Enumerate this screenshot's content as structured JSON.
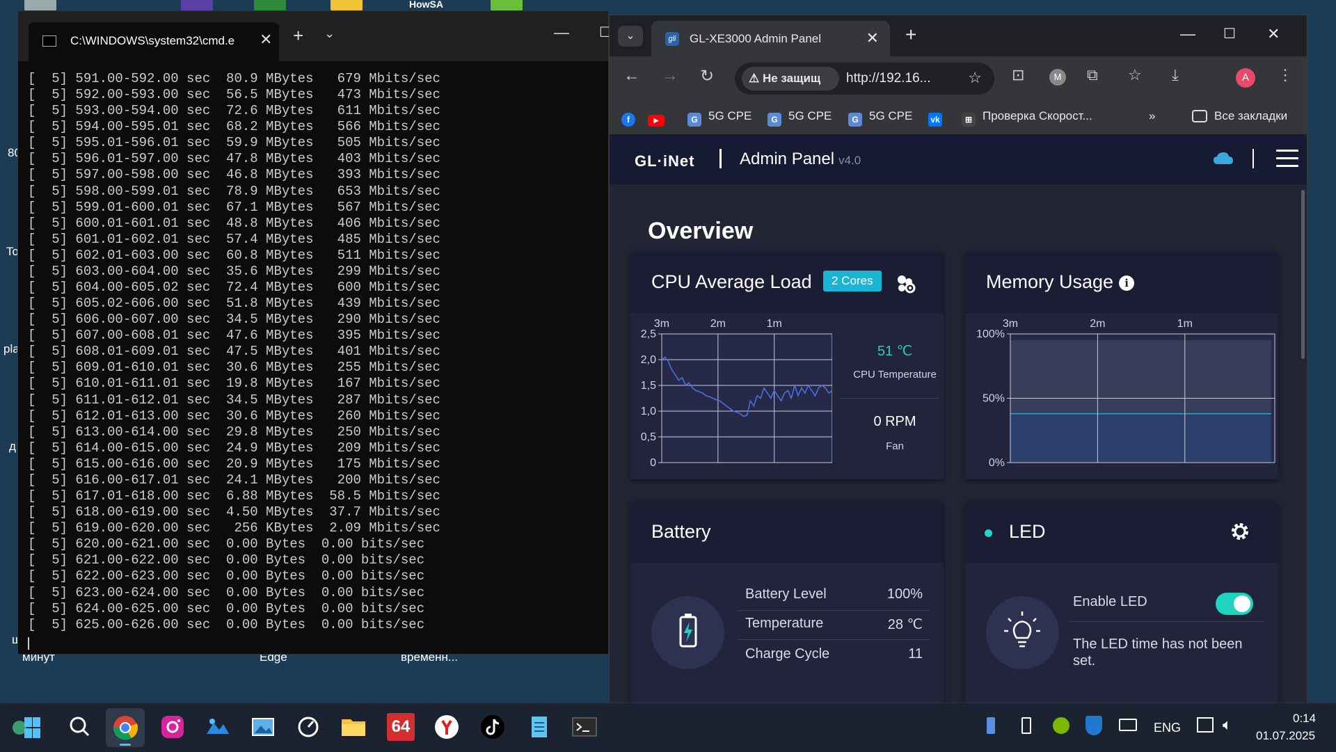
{
  "desktop": {
    "labels": [
      "80",
      "To",
      "pla",
      "д",
      "ш",
      "минут",
      "Edge",
      "временн...",
      "HowSA"
    ]
  },
  "terminal": {
    "tab_title": "C:\\WINDOWS\\system32\\cmd.e",
    "lines": [
      "[  5] 591.00-592.00 sec  80.9 MBytes   679 Mbits/sec",
      "[  5] 592.00-593.00 sec  56.5 MBytes   473 Mbits/sec",
      "[  5] 593.00-594.00 sec  72.6 MBytes   611 Mbits/sec",
      "[  5] 594.00-595.01 sec  68.2 MBytes   566 Mbits/sec",
      "[  5] 595.01-596.01 sec  59.9 MBytes   505 Mbits/sec",
      "[  5] 596.01-597.00 sec  47.8 MBytes   403 Mbits/sec",
      "[  5] 597.00-598.00 sec  46.8 MBytes   393 Mbits/sec",
      "[  5] 598.00-599.01 sec  78.9 MBytes   653 Mbits/sec",
      "[  5] 599.01-600.01 sec  67.1 MBytes   567 Mbits/sec",
      "[  5] 600.01-601.01 sec  48.8 MBytes   406 Mbits/sec",
      "[  5] 601.01-602.01 sec  57.4 MBytes   485 Mbits/sec",
      "[  5] 602.01-603.00 sec  60.8 MBytes   511 Mbits/sec",
      "[  5] 603.00-604.00 sec  35.6 MBytes   299 Mbits/sec",
      "[  5] 604.00-605.02 sec  72.4 MBytes   600 Mbits/sec",
      "[  5] 605.02-606.00 sec  51.8 MBytes   439 Mbits/sec",
      "[  5] 606.00-607.00 sec  34.5 MBytes   290 Mbits/sec",
      "[  5] 607.00-608.01 sec  47.6 MBytes   395 Mbits/sec",
      "[  5] 608.01-609.01 sec  47.5 MBytes   401 Mbits/sec",
      "[  5] 609.01-610.01 sec  30.6 MBytes   255 Mbits/sec",
      "[  5] 610.01-611.01 sec  19.8 MBytes   167 Mbits/sec",
      "[  5] 611.01-612.01 sec  34.5 MBytes   287 Mbits/sec",
      "[  5] 612.01-613.00 sec  30.6 MBytes   260 Mbits/sec",
      "[  5] 613.00-614.00 sec  29.8 MBytes   250 Mbits/sec",
      "[  5] 614.00-615.00 sec  24.9 MBytes   209 Mbits/sec",
      "[  5] 615.00-616.00 sec  20.9 MBytes   175 Mbits/sec",
      "[  5] 616.00-617.01 sec  24.1 MBytes   200 Mbits/sec",
      "[  5] 617.01-618.00 sec  6.88 MBytes  58.5 Mbits/sec",
      "[  5] 618.00-619.00 sec  4.50 MBytes  37.7 Mbits/sec",
      "[  5] 619.00-620.00 sec   256 KBytes  2.09 Mbits/sec",
      "[  5] 620.00-621.00 sec  0.00 Bytes  0.00 bits/sec",
      "[  5] 621.00-622.00 sec  0.00 Bytes  0.00 bits/sec",
      "[  5] 622.00-623.00 sec  0.00 Bytes  0.00 bits/sec",
      "[  5] 623.00-624.00 sec  0.00 Bytes  0.00 bits/sec",
      "[  5] 624.00-625.00 sec  0.00 Bytes  0.00 bits/sec",
      "[  5] 625.00-626.00 sec  0.00 Bytes  0.00 bits/sec"
    ]
  },
  "browser": {
    "tab_title": "GL-XE3000 Admin Panel",
    "favicon_text": "gli",
    "security_label": "Не защищ",
    "url": "http://192.16...",
    "profile_letter": "A",
    "ext_letter": "M",
    "bookmarks": [
      {
        "label": "5G CPE"
      },
      {
        "label": "5G CPE"
      },
      {
        "label": "5G CPE"
      },
      {
        "label": "Проверка Скорост..."
      }
    ],
    "all_bookmarks": "Все закладки"
  },
  "app": {
    "logo": "GL·iNet",
    "title": "Admin Panel",
    "version": "v4.0",
    "overview": "Overview",
    "cpu_card": {
      "title": "CPU Average Load",
      "cores_badge": "2 Cores",
      "temperature": "51 ℃",
      "temperature_label": "CPU Temperature",
      "fan": "0 RPM",
      "fan_label": "Fan"
    },
    "memory_card": {
      "title": "Memory Usage"
    },
    "battery_card": {
      "title": "Battery",
      "rows": [
        {
          "key": "Battery Level",
          "value": "100%"
        },
        {
          "key": "Temperature",
          "value": "28 ℃"
        },
        {
          "key": "Charge Cycle",
          "value": "11"
        }
      ]
    },
    "led_card": {
      "title": "LED",
      "enable_label": "Enable LED",
      "enabled": true,
      "note": "The LED time has not been set."
    }
  },
  "chart_data": [
    {
      "type": "line",
      "title": "CPU Average Load",
      "x_ticks": [
        "3m",
        "2m",
        "1m"
      ],
      "y_ticks": [
        "2,5",
        "2,0",
        "1,5",
        "1,0",
        "0,5",
        "0"
      ],
      "ylim": [
        0,
        2.5
      ],
      "x": [
        0,
        2,
        4,
        6,
        8,
        10,
        12,
        14,
        16,
        18,
        20,
        22,
        24,
        26,
        28,
        30,
        32,
        34,
        36,
        38,
        40,
        42,
        44,
        46,
        48,
        50,
        52,
        54,
        56,
        58,
        60,
        62,
        64,
        66,
        68,
        70,
        72,
        74,
        76,
        78,
        80,
        82,
        84,
        86,
        88,
        90,
        92,
        94,
        96,
        98,
        100
      ],
      "values": [
        2.0,
        2.05,
        1.95,
        1.8,
        1.7,
        1.6,
        1.65,
        1.5,
        1.55,
        1.45,
        1.4,
        1.38,
        1.35,
        1.3,
        1.28,
        1.25,
        1.22,
        1.2,
        1.15,
        1.1,
        1.05,
        1.0,
        0.98,
        0.95,
        0.9,
        0.92,
        1.2,
        1.1,
        1.3,
        1.25,
        1.45,
        1.35,
        1.25,
        1.4,
        1.3,
        1.2,
        1.35,
        1.4,
        1.25,
        1.5,
        1.3,
        1.45,
        1.35,
        1.5,
        1.4,
        1.3,
        1.45,
        1.5,
        1.45,
        1.35,
        1.4
      ],
      "color": "#4a6fe0"
    },
    {
      "type": "area",
      "title": "Memory Usage",
      "x_ticks": [
        "3m",
        "2m",
        "1m"
      ],
      "y_ticks": [
        "100%",
        "50%",
        "0%"
      ],
      "ylim": [
        0,
        100
      ],
      "series": [
        {
          "values": [
            95,
            95
          ],
          "color": "#3a3d5a"
        },
        {
          "values": [
            38,
            38
          ],
          "color": "#2aa3c8"
        }
      ]
    }
  ],
  "taskbar": {
    "lang": "ENG",
    "time": "0:14",
    "date": "01.07.2025",
    "badge_64": "64"
  },
  "colors": {
    "accent": "#1ab5d3",
    "header_bg": "#161a33",
    "card_bg": "#1b1d34"
  }
}
